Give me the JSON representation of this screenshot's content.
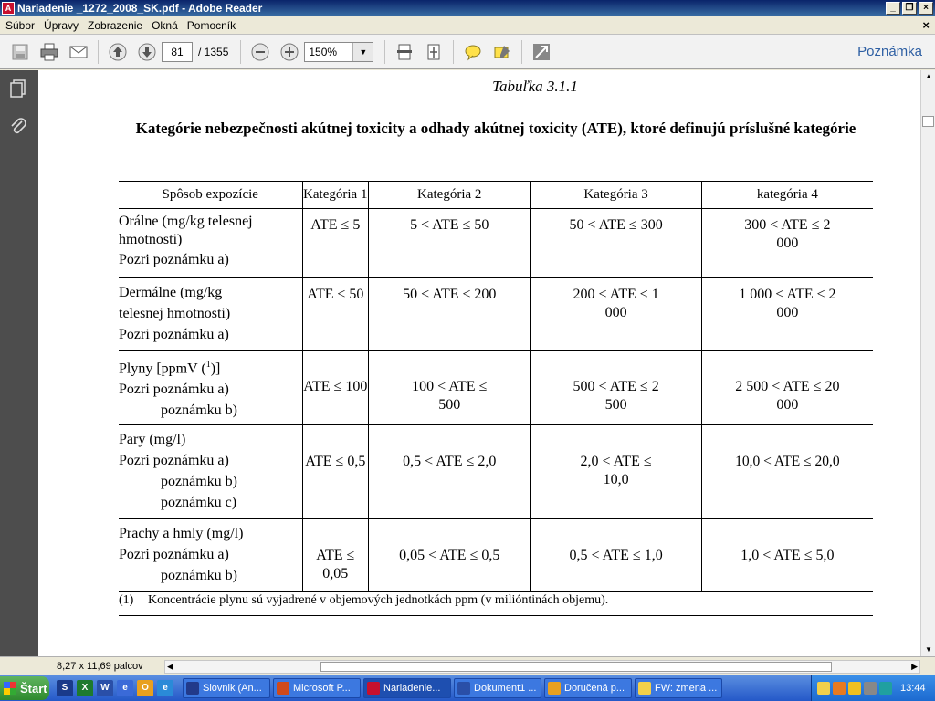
{
  "window": {
    "title": "Nariadenie _1272_2008_SK.pdf - Adobe Reader"
  },
  "menu": {
    "items": [
      "Súbor",
      "Úpravy",
      "Zobrazenie",
      "Okná",
      "Pomocník"
    ]
  },
  "toolbar": {
    "page_current": "81",
    "page_total": "/ 1355",
    "zoom": "150%",
    "comment_label": "Poznámka"
  },
  "document": {
    "table_title": "Tabuľka 3.1.1",
    "heading": "Kategórie nebezpečnosti akútnej toxicity a odhady akútnej toxicity (ATE), ktoré definujú príslušné kategórie",
    "columns": [
      "Spôsob expozície",
      "Kategória 1",
      "Kategória 2",
      "Kategória 3",
      "kategória 4"
    ],
    "rows": [
      {
        "route": [
          "Orálne (mg/kg telesnej hmotnosti)"
        ],
        "notes": [
          "Pozri poznámku a)"
        ],
        "values": [
          "ATE ≤ 5",
          "5 < ATE ≤ 50",
          "50 < ATE ≤ 300",
          "300 < ATE ≤ 2 000"
        ]
      },
      {
        "route": [
          "Dermálne (mg/kg telesnej hmotnosti)"
        ],
        "notes": [
          "Pozri poznámku a)"
        ],
        "values": [
          "ATE ≤ 50",
          "50 < ATE ≤ 200",
          "200 < ATE ≤ 1 000",
          "1 000 < ATE ≤ 2 000"
        ]
      },
      {
        "route": [
          "Plyny [ppmV (",
          "1",
          ")]"
        ],
        "notes": [
          "Pozri poznámku a)",
          "poznámku b)"
        ],
        "values": [
          "ATE ≤ 100",
          "100 < ATE ≤ 500",
          "500 < ATE ≤ 2 500",
          "2 500 < ATE ≤ 20 000"
        ]
      },
      {
        "route": [
          "Pary (mg/l)"
        ],
        "notes": [
          "Pozri poznámku a)",
          "poznámku b)",
          "poznámku c)"
        ],
        "values": [
          "ATE ≤ 0,5",
          "0,5 < ATE ≤ 2,0",
          "2,0 < ATE ≤ 10,0",
          "10,0 < ATE ≤ 20,0"
        ]
      },
      {
        "route": [
          "Prachy a hmly (mg/l)"
        ],
        "notes": [
          "Pozri poznámku a)",
          "poznámku b)"
        ],
        "values": [
          "ATE ≤ 0,05",
          "0,05 < ATE ≤ 0,5",
          "0,5 < ATE ≤ 1,0",
          "1,0 < ATE ≤ 5,0"
        ]
      }
    ],
    "footnote_mark": "(1)",
    "footnote_text": "Koncentrácie plynu sú vyjadrené v objemových jednotkách ppm (v milióntinách objemu)."
  },
  "status": {
    "page_size": "8,27 x 11,69 palcov"
  },
  "taskbar": {
    "start": "Štart",
    "tasks": [
      "Slovnik (An...",
      "Microsoft P...",
      "Nariadenie...",
      "Dokument1 ...",
      "Doručená p...",
      "FW: zmena ..."
    ],
    "clock": "13:44"
  }
}
